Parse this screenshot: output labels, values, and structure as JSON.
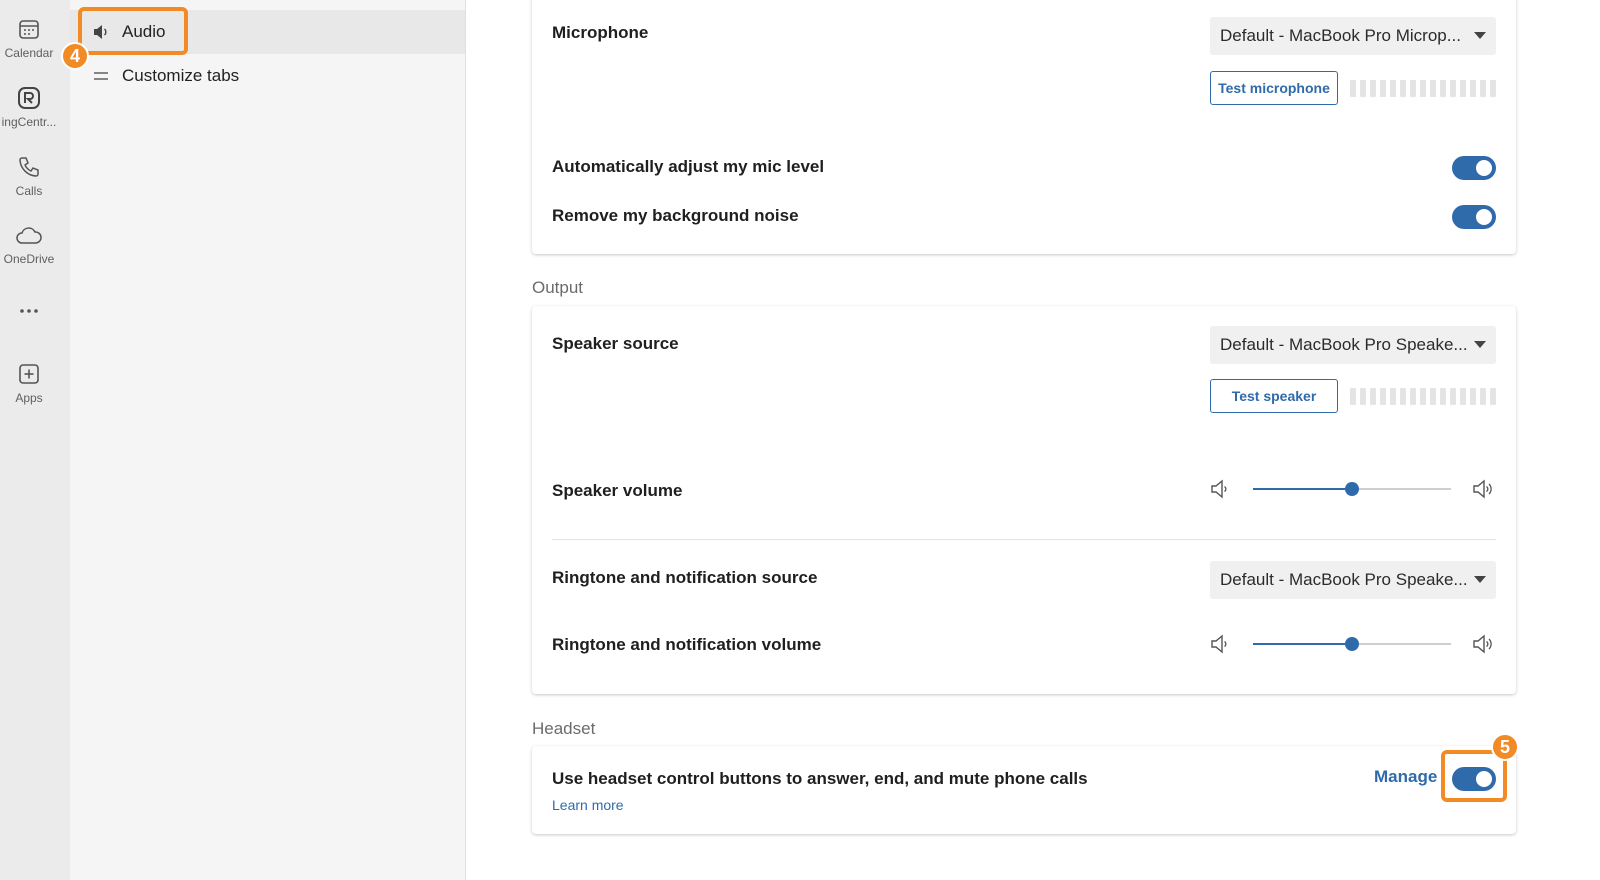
{
  "rail": {
    "items": [
      {
        "label": "Calendar",
        "icon": "calendar-icon"
      },
      {
        "label": "ingCentr...",
        "icon": "ringcentral-icon"
      },
      {
        "label": "Calls",
        "icon": "phone-icon"
      },
      {
        "label": "OneDrive",
        "icon": "cloud-icon"
      },
      {
        "label": "",
        "icon": "more-icon"
      },
      {
        "label": "Apps",
        "icon": "add-app-icon"
      }
    ]
  },
  "nav": {
    "items": [
      {
        "label": "Audio",
        "icon": "speaker-icon",
        "active": true
      },
      {
        "label": "Customize tabs",
        "icon": "menu-lines-icon",
        "active": false
      }
    ]
  },
  "callouts": {
    "audio_step": "4",
    "headset_step": "5",
    "color": "#f28a25"
  },
  "input": {
    "microphone_label": "Microphone",
    "microphone_value": "Default - MacBook Pro Microp...",
    "test_microphone": "Test microphone",
    "auto_adjust_label": "Automatically adjust my mic level",
    "auto_adjust_on": true,
    "noise_label": "Remove my background noise",
    "noise_on": true
  },
  "output": {
    "section_title": "Output",
    "speaker_source_label": "Speaker source",
    "speaker_source_value": "Default - MacBook Pro Speake...",
    "test_speaker": "Test speaker",
    "speaker_volume_label": "Speaker volume",
    "speaker_volume_fraction": 0.5,
    "ringtone_source_label": "Ringtone and notification source",
    "ringtone_source_value": "Default - MacBook Pro Speake...",
    "ringtone_volume_label": "Ringtone and notification volume",
    "ringtone_volume_fraction": 0.5
  },
  "headset": {
    "section_title": "Headset",
    "control_label": "Use headset control buttons to answer, end, and mute phone calls",
    "learn_more": "Learn more",
    "manage": "Manage",
    "control_on": true
  },
  "colors": {
    "accent": "#2f6bab",
    "highlight": "#f28a25"
  }
}
